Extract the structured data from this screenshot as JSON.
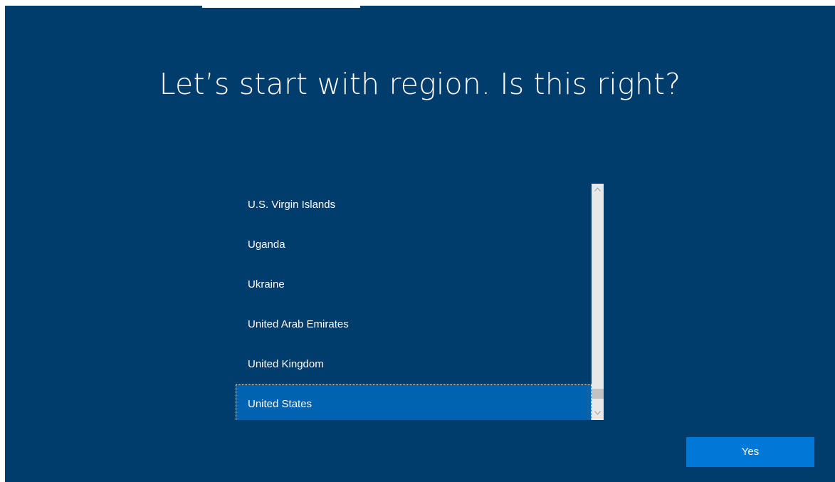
{
  "title": "Let’s start with region. Is this right?",
  "regions": [
    {
      "label": "U.S. Virgin Islands"
    },
    {
      "label": "Uganda"
    },
    {
      "label": "Ukraine"
    },
    {
      "label": "United Arab Emirates"
    },
    {
      "label": "United Kingdom"
    },
    {
      "label": "United States",
      "selected": true
    }
  ],
  "buttons": {
    "yes_label": "Yes"
  },
  "colors": {
    "background": "#003c6c",
    "selected_item": "#0063b1",
    "button": "#0078d7",
    "text": "#ffffff"
  },
  "icons": {
    "scroll_up": "chevron-up-icon",
    "scroll_down": "chevron-down-icon"
  }
}
